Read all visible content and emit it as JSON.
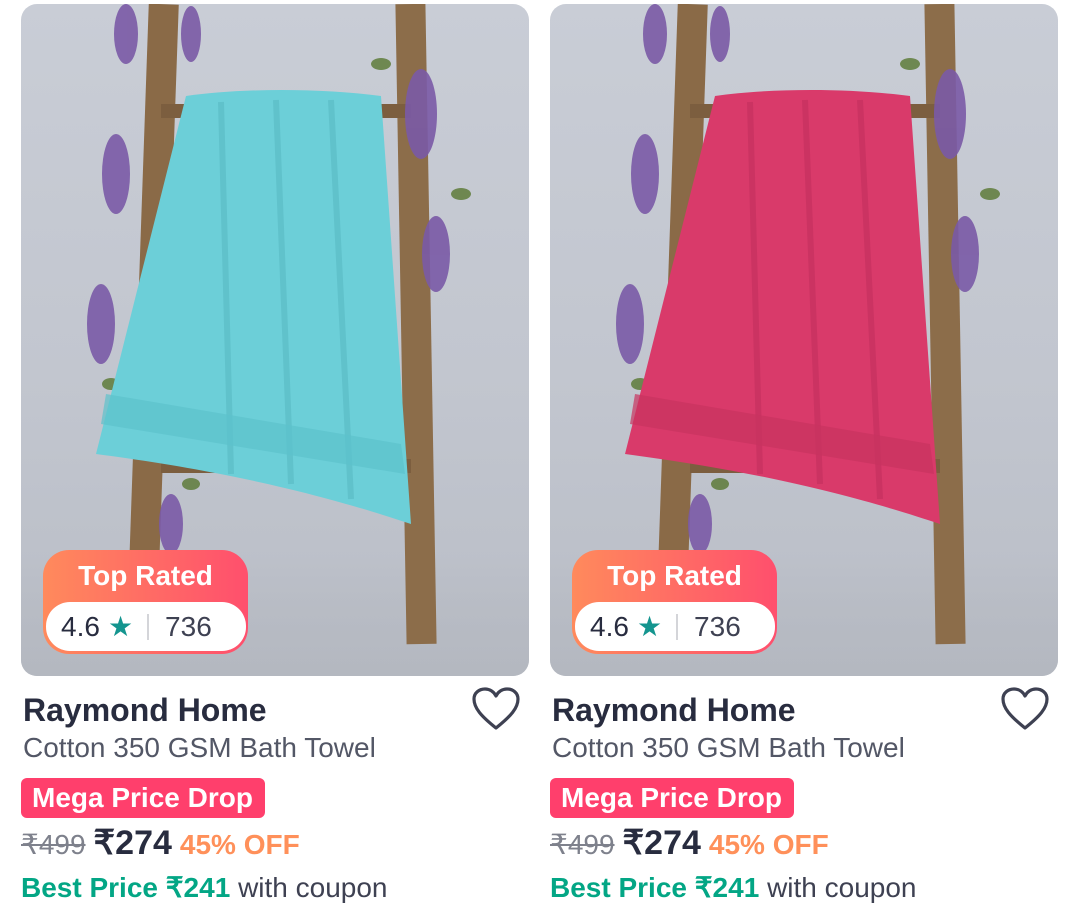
{
  "products": [
    {
      "badge": "Top Rated",
      "rating": "4.6",
      "rating_count": "736",
      "brand": "Raymond Home",
      "name": "Cotton 350 GSM Bath Towel",
      "tag": "Mega Price Drop",
      "mrp": "₹499",
      "price": "₹274",
      "discount": "45% OFF",
      "best_price": "Best Price ₹241",
      "best_suffix": "with coupon",
      "towel_color": "#6ccfd8"
    },
    {
      "badge": "Top Rated",
      "rating": "4.6",
      "rating_count": "736",
      "brand": "Raymond Home",
      "name": "Cotton 350 GSM Bath Towel",
      "tag": "Mega Price Drop",
      "mrp": "₹499",
      "price": "₹274",
      "discount": "45% OFF",
      "best_price": "Best Price ₹241",
      "best_suffix": "with coupon",
      "towel_color": "#d93a6a"
    }
  ],
  "icons": {
    "star": "star-icon",
    "wishlist": "heart-icon"
  },
  "colors": {
    "accent": "#ff3f6c",
    "best_price": "#03a685",
    "discount": "#ff905a",
    "rating_star": "#14958f"
  }
}
